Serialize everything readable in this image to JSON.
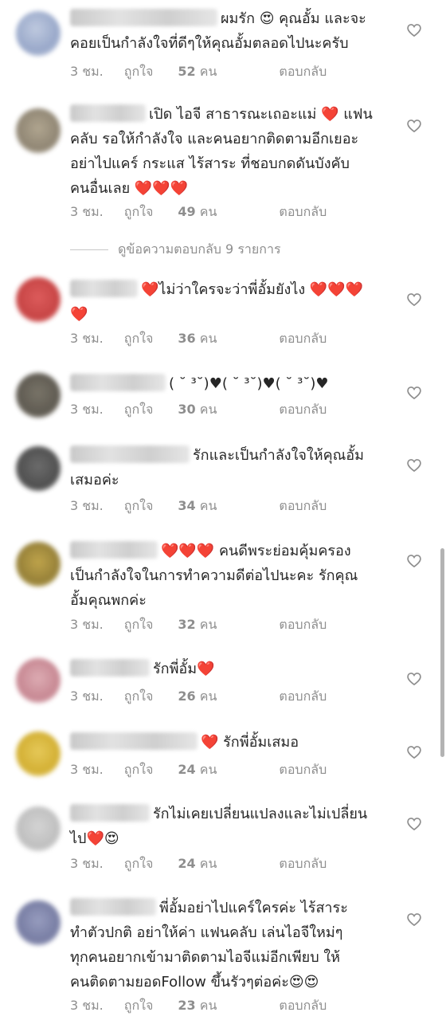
{
  "replies_toggle": "ดูข้อความตอบกลับ 9 รายการ",
  "reply_label": "ตอบกลับ",
  "time_ago": "3 ชม.",
  "likes_prefix": "ถูกใจ",
  "likes_suffix": "คน",
  "colors": {
    "text": "#262626",
    "meta": "#8e8e8e",
    "heart": "#e0201f"
  },
  "comments": [
    {
      "text": "ผมรัก 😍 คุณอั้ม และจะ\nคอยเป็นกำลังใจที่ดีๆให้คุณอั้มตลอดไปนะครับ",
      "likes": "52"
    },
    {
      "text": "เปิด ไอจี สาธารณะเถอะแม่ ❤️ แฟน\nคลับ รอให้กำลังใจ และคนอยากติดตามอีกเยอะ\nอย่าไปแคร์ กระแส ไร้สาระ ที่ชอบกดดันบังคับ\nคนอื่นเลย ❤️❤️❤️",
      "likes": "49"
    },
    {
      "text": "❤️ไม่ว่าใครจะว่าพี่อั้มยังไง ❤️❤️❤️\n❤️",
      "likes": "36"
    },
    {
      "text": "( ˘ ³˘)♥( ˘ ³˘)♥( ˘ ³˘)♥",
      "likes": "30"
    },
    {
      "text": "รักและเป็นกำลังใจให้คุณอั้ม\nเสมอค่ะ",
      "likes": "34"
    },
    {
      "text": "❤️❤️❤️ คนดีพระย่อมคุ้มครอง\nเป็นกำลังใจในการทำความดีต่อไปนะคะ รักคุณ\nอั้มคุณพกค่ะ",
      "likes": "32"
    },
    {
      "text": "รักพี่อั้ม❤️",
      "likes": "26"
    },
    {
      "text": "❤️ รักพี่อั้มเสมอ",
      "likes": "24"
    },
    {
      "text": "รักไม่เคยเปลี่ยนแปลงและไม่เปลี่ยน\nไป❤️😍",
      "likes": "24"
    },
    {
      "text": "พี่อั้มอย่าไปแคร์ใครค่ะ ไร้สาระ\nทำตัวปกติ อย่าให้ค่า แฟนคลับ เล่นไอจีใหม่ๆ\nทุกคนอยากเข้ามาติดตามไอจีแม่อีกเพียบ ให้\nคนติดตามยอดFollow ขึ้นรัวๆต่อค่ะ😍😍",
      "likes": "23"
    }
  ]
}
